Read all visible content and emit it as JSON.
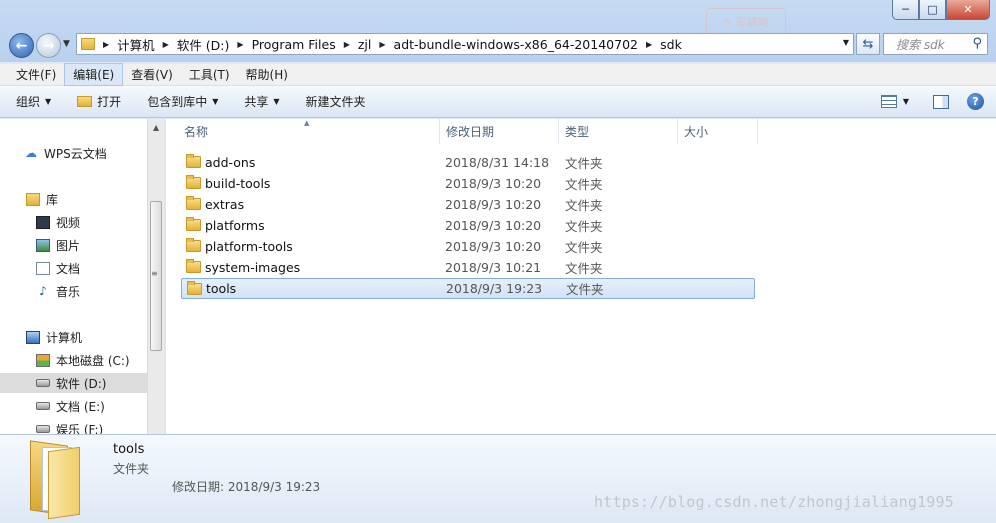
{
  "window": {
    "controls": {
      "minimize": "─",
      "maximize": "□",
      "close": "✕"
    },
    "ghost_stamp": "✎ 写稿略"
  },
  "address": {
    "crumbs": [
      "计算机",
      "软件 (D:)",
      "Program Files",
      "zjl",
      "adt-bundle-windows-x86_64-20140702",
      "sdk"
    ],
    "search_placeholder": "搜索 sdk"
  },
  "menu": [
    "文件(F)",
    "编辑(E)",
    "查看(V)",
    "工具(T)",
    "帮助(H)"
  ],
  "toolbar": {
    "organize": "组织",
    "open": "打开",
    "include_library": "包含到库中",
    "share": "共享",
    "new_folder": "新建文件夹"
  },
  "navigation": {
    "wps_cloud": "WPS云文档",
    "library": "库",
    "videos": "视频",
    "pictures": "图片",
    "documents": "文档",
    "music": "音乐",
    "computer": "计算机",
    "drive_c": "本地磁盘 (C:)",
    "drive_d": "软件 (D:)",
    "drive_e": "文档 (E:)",
    "drive_f": "娱乐 (F:)"
  },
  "columns": {
    "name": "名称",
    "date": "修改日期",
    "type": "类型",
    "size": "大小"
  },
  "files": [
    {
      "name": "add-ons",
      "date": "2018/8/31 14:18",
      "type": "文件夹"
    },
    {
      "name": "build-tools",
      "date": "2018/9/3 10:20",
      "type": "文件夹"
    },
    {
      "name": "extras",
      "date": "2018/9/3 10:20",
      "type": "文件夹"
    },
    {
      "name": "platforms",
      "date": "2018/9/3 10:20",
      "type": "文件夹"
    },
    {
      "name": "platform-tools",
      "date": "2018/9/3 10:20",
      "type": "文件夹"
    },
    {
      "name": "system-images",
      "date": "2018/9/3 10:21",
      "type": "文件夹"
    },
    {
      "name": "tools",
      "date": "2018/9/3 19:23",
      "type": "文件夹"
    }
  ],
  "details": {
    "name": "tools",
    "type": "文件夹",
    "modified": "修改日期: 2018/9/3 19:23"
  },
  "watermark": "https://blog.csdn.net/zhongjialiang1995"
}
